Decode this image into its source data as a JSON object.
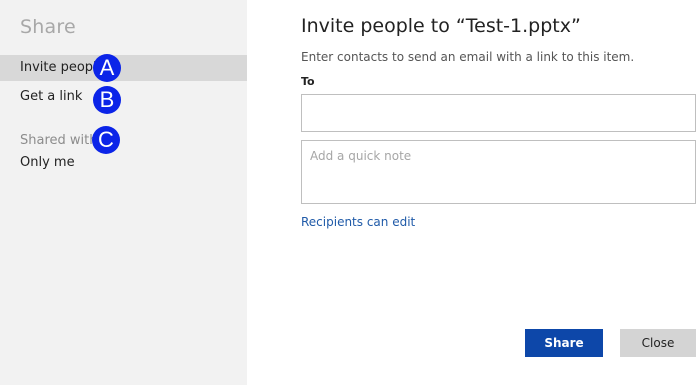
{
  "sidebar": {
    "title": "Share",
    "items": [
      {
        "label": "Invite people",
        "selected": true
      },
      {
        "label": "Get a link",
        "selected": false
      }
    ],
    "shared_with_label": "Shared with",
    "shared_with_value": "Only me"
  },
  "annotations": {
    "a": "A",
    "b": "B",
    "c": "C",
    "color": "#0b24e8"
  },
  "main": {
    "title": "Invite people to “Test-1.pptx”",
    "instructions": "Enter contacts to send an email with a link to this item.",
    "to_label": "To",
    "to_value": "",
    "note_placeholder": "Add a quick note",
    "permissions_link": "Recipients can edit",
    "share_button": "Share",
    "close_button": "Close"
  },
  "colors": {
    "sidebar_bg": "#f2f2f2",
    "selected_bg": "#d8d8d8",
    "primary_button": "#0d47a9",
    "secondary_button": "#d4d4d4",
    "link": "#1f5aa8"
  }
}
